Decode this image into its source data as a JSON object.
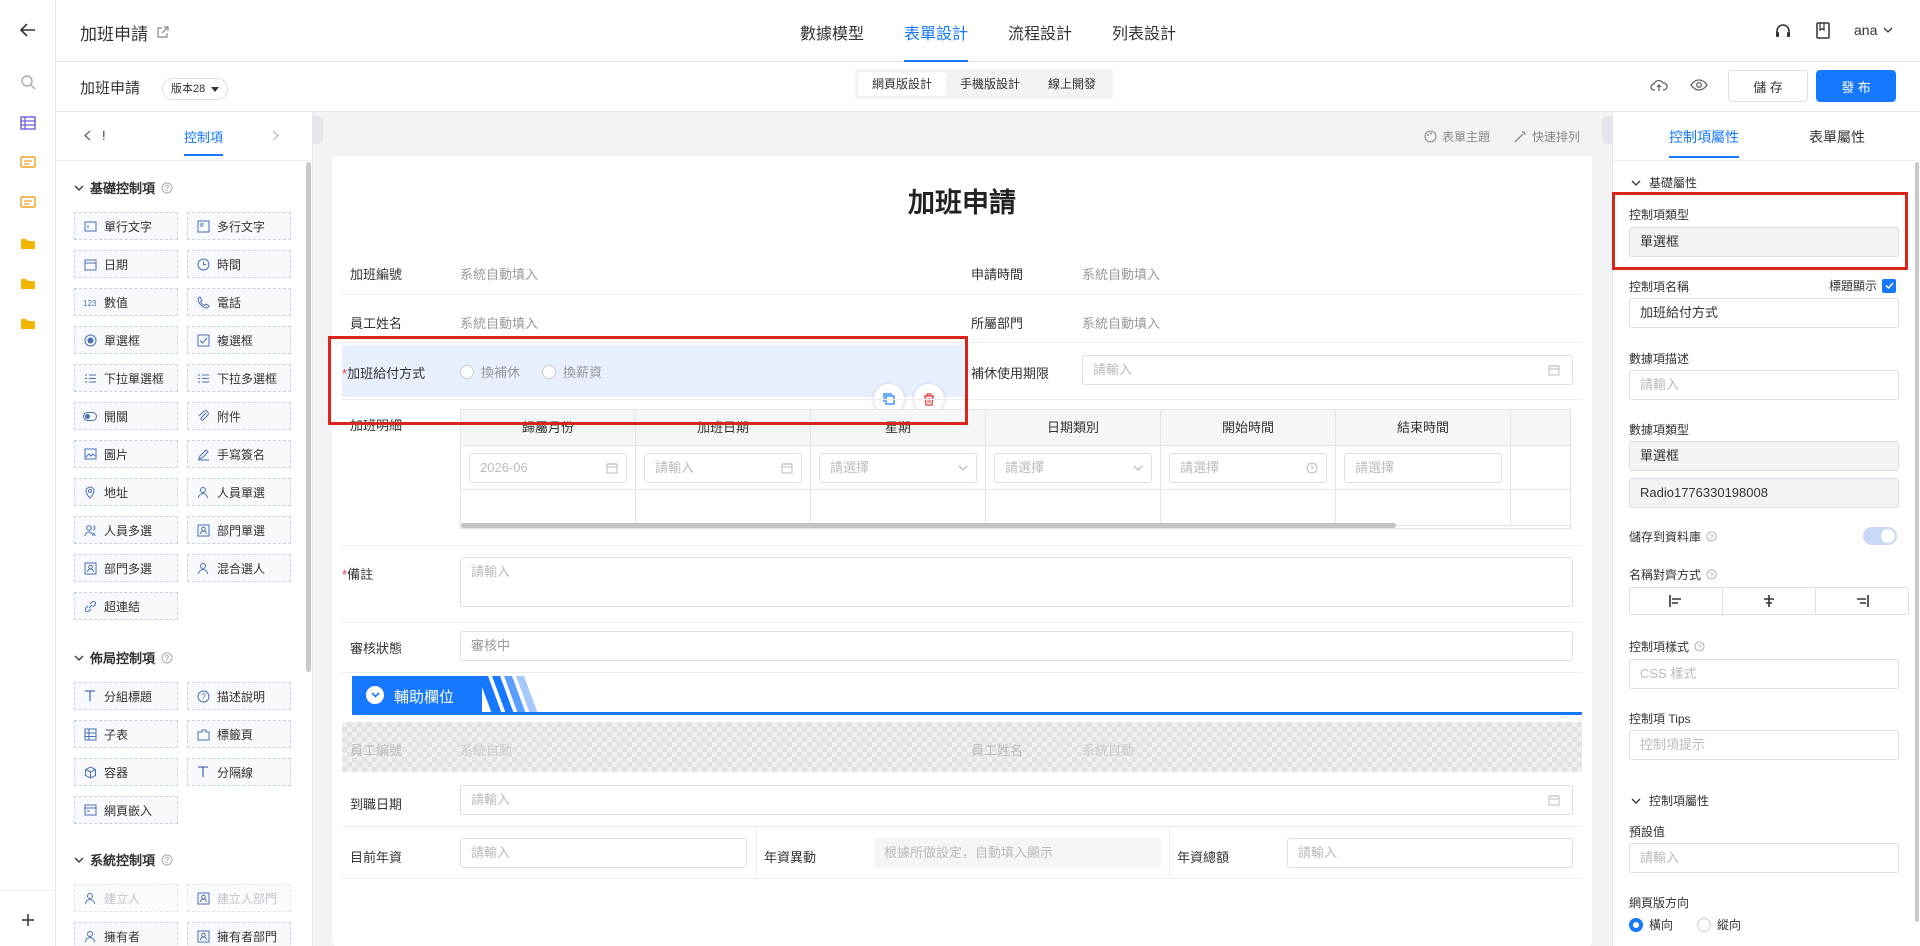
{
  "header": {
    "title": "加班申請",
    "nav": [
      "數據模型",
      "表單設計",
      "流程設計",
      "列表設計"
    ],
    "active_nav": "表單設計",
    "user": "ana"
  },
  "subbar": {
    "form_name": "加班申請",
    "version": "版本28",
    "modes": [
      "網頁版設計",
      "手機版設計",
      "線上開發"
    ],
    "save": "儲 存",
    "publish": "發 布"
  },
  "left": {
    "back_marker": "!",
    "tab": "控制項",
    "basic_title": "基礎控制項",
    "basic": [
      "單行文字",
      "多行文字",
      "日期",
      "時間",
      "數值",
      "電話",
      "單選框",
      "複選框",
      "下拉單選框",
      "下拉多選框",
      "開關",
      "附件",
      "圖片",
      "手寫簽名",
      "地址",
      "人員單選",
      "人員多選",
      "部門單選",
      "部門多選",
      "混合選人",
      "超連結"
    ],
    "layout_title": "佈局控制項",
    "layout": [
      "分組標題",
      "描述說明",
      "子表",
      "標籤頁",
      "容器",
      "分隔線",
      "網頁嵌入"
    ],
    "system_title": "系統控制項",
    "system": [
      "建立人",
      "建立人部門",
      "擁有者",
      "擁有者部門"
    ]
  },
  "canvas": {
    "theme": "表單主題",
    "arrange": "快速排列",
    "form_title": "加班申請",
    "auto": "系統自動填入",
    "f_no": "加班編號",
    "f_apply_time": "申請時間",
    "f_name": "員工姓名",
    "f_dept": "所屬部門",
    "f_pay": "加班給付方式",
    "pay_opts": [
      "換補休",
      "換薪資"
    ],
    "f_period": "補休使用期限",
    "ph_input": "請輸入",
    "ph_select": "請選擇",
    "f_detail": "加班明細",
    "cols": [
      "歸屬月份",
      "加班日期",
      "星期",
      "日期類別",
      "開始時間",
      "結束時間"
    ],
    "month_val": "2026-06",
    "f_note": "備註",
    "f_status": "審核狀態",
    "status_val": "審核中",
    "group_title": "輔助欄位",
    "hid_no": "員工編號",
    "hid_name": "員工姓名",
    "hid_val": "系統自動",
    "f_join": "到職日期",
    "f_salary": "目前年資",
    "f_change": "年資異動",
    "change_hint": "根據所做設定，自動填入顯示",
    "f_total": "年資總額"
  },
  "right": {
    "tabs": [
      "控制項屬性",
      "表單屬性"
    ],
    "basic_section": "基礎屬性",
    "type_label": "控制項類型",
    "type_val": "單選框",
    "name_label": "控制項名稱",
    "show_title": "標題顯示",
    "name_val": "加班給付方式",
    "desc_label": "數據項描述",
    "desc_ph": "請輸入",
    "dtype_label": "數據項類型",
    "dtype_val": "單選框",
    "id_val": "Radio1776330198008",
    "store_label": "儲存到資料庫",
    "align_label": "名稱對齊方式",
    "style_label": "控制項樣式",
    "style_ph": "CSS 樣式",
    "tips_label": "控制項 Tips",
    "tips_ph": "控制項提示",
    "ctl_section": "控制項屬性",
    "default_label": "預設值",
    "default_ph": "請輸入",
    "dir_label": "網頁版方向",
    "dir_opts": [
      "橫向",
      "縱向"
    ]
  }
}
